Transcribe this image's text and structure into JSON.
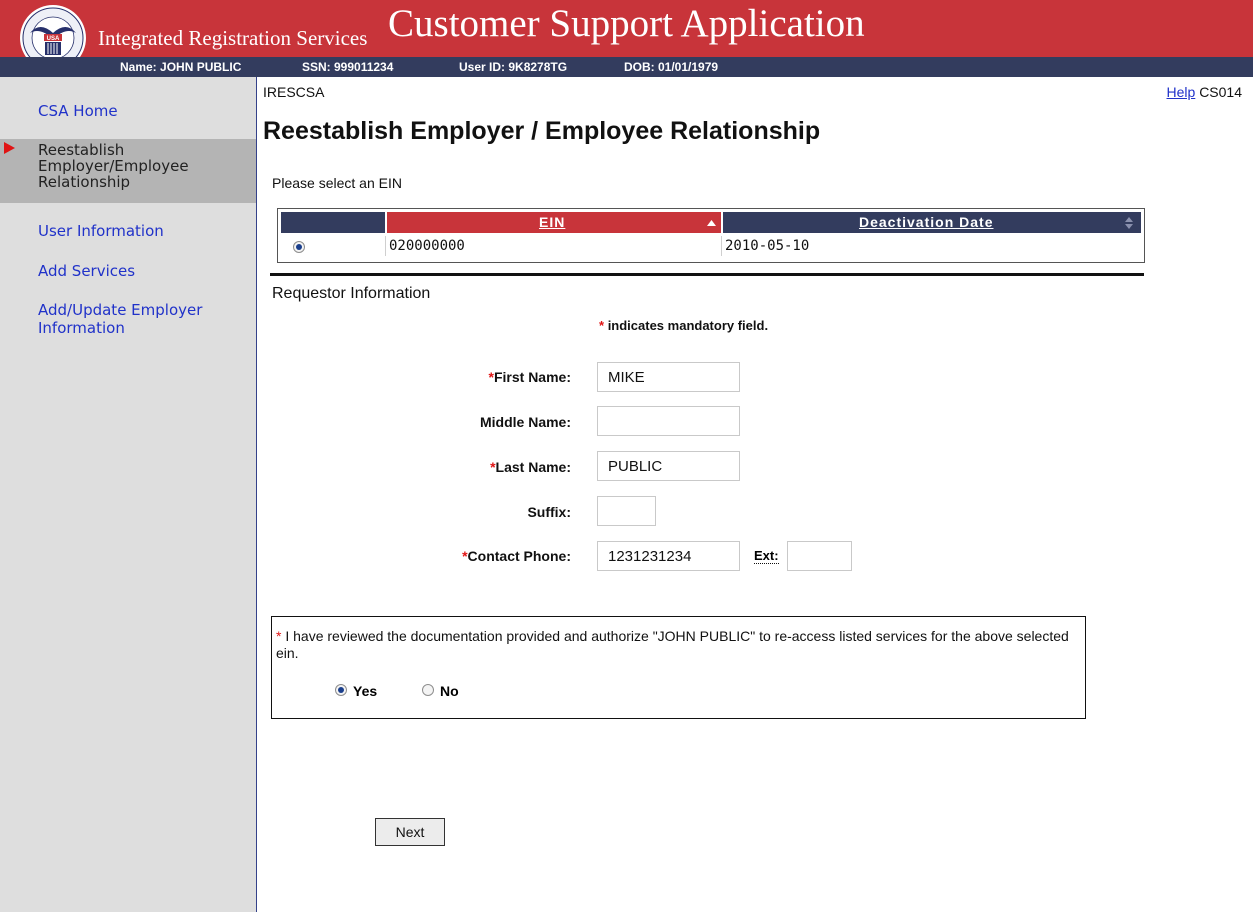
{
  "header": {
    "subtitle": "Integrated Registration Services",
    "app_title": "Customer Support Application",
    "logo_text": "SOCIAL SECURITY ADMINISTRATION USA"
  },
  "infobar": {
    "name": "Name: JOHN PUBLIC",
    "ssn": "SSN: 999011234",
    "user_id": "User ID: 9K8278TG",
    "dob": "DOB: 01/01/1979"
  },
  "sidebar": {
    "items": [
      {
        "label": "CSA Home"
      },
      {
        "label": "Reestablish Employer/Employee Relationship"
      },
      {
        "label": "User Information"
      },
      {
        "label": "Add Services"
      },
      {
        "label": "Add/Update Employer Information"
      }
    ],
    "active_index": 1
  },
  "main": {
    "app_code": "IRESCSA",
    "help_link": "Help",
    "screen_id": "CS014",
    "title": "Reestablish Employer / Employee Relationship",
    "instruction": "Please select an EIN",
    "table": {
      "columns": [
        "EIN",
        "Deactivation Date"
      ],
      "rows": [
        {
          "selected": true,
          "ein": "020000000",
          "deactivation_date": "2010-05-10"
        }
      ]
    },
    "section_title": "Requestor Information",
    "mandatory_marker": "*",
    "mandatory_note": "indicates mandatory field.",
    "form": {
      "first_name_label": "First Name:",
      "first_name_value": "MIKE",
      "middle_name_label": "Middle Name:",
      "middle_name_value": "",
      "last_name_label": "Last Name:",
      "last_name_value": "PUBLIC",
      "suffix_label": "Suffix:",
      "suffix_value": "",
      "phone_label": "Contact Phone:",
      "phone_value": "1231231234",
      "ext_label": "Ext:",
      "ext_value": ""
    },
    "authorization": {
      "text": "I have reviewed the documentation provided and authorize \"JOHN PUBLIC\" to re-access listed services for the above selected ein.",
      "yes_label": "Yes",
      "no_label": "No",
      "selected": "Yes"
    },
    "next_label": "Next"
  },
  "colors": {
    "header_red": "#c8343a",
    "infobar_navy": "#333c5e",
    "link_blue": "#2032c9",
    "required_red": "#e01414",
    "table_header_navy": "#333c5e",
    "table_header_red": "#c8343a"
  }
}
